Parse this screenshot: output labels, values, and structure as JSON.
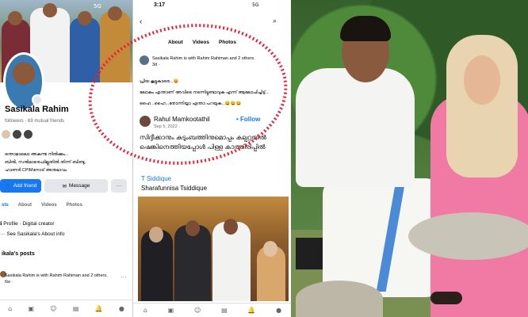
{
  "left": {
    "status_bar": "5G",
    "profile_name": "Sasikala Rahim",
    "followers_label": "followers",
    "mutual_friends": "69 mutual friends",
    "bio_lines": [
      "ന്തൊമാലൊ അകന്നു നിൽക്കും...",
      "ബിൽ, സൽമാരെഫില്ലതിൽ തിന്ന് ബിണ്ടു,",
      "ഹാണർ CPIMനോട് അനുഭാവം"
    ],
    "add_friend_label": "Add friend",
    "message_label": "Message",
    "more_label": "···",
    "tabs": [
      "sts",
      "About",
      "Videos",
      "Photos"
    ],
    "details": [
      "Profile · Digital creator",
      "See Sasikala's About info"
    ],
    "posts_heading": "ikala's posts",
    "post_line": "Sasikala Rahim is with Rahim Rahiman and 2 others.",
    "post_line_meta": "6w · ",
    "post_more": "···"
  },
  "mid": {
    "time": "3:17",
    "status_icons": "5G",
    "back_icon": "‹",
    "search_icon": "⌕",
    "tabs": [
      "About",
      "Videos",
      "Photos"
    ],
    "post_header": "Sasikala Rahim is with Rahim Rahiman and 2 others.",
    "post_meta": "3d · ",
    "post_line1": "പ്രിയ കൂട്ടുകാരെ...😀",
    "post_line2": "ലോകം എന്താണ് അവിടെ നടന്നിട്ടുണ്ടാവുക എന്ന് ആലോചിച്ചിട്ട്...",
    "post_line3": "ഹൈ...ഹൈ...തോന്നിയ്യാ എന്താ പറയുക...😀😀😀",
    "shared_name": "Rahul Mamkootathil",
    "shared_follow": "Follow",
    "shared_date": "Sep 5, 2022 · ",
    "shared_text": "സിദ്ദീക്കാനും കുടുംബത്തിനുമൊപ്പം കല്പറ്റയിൽ ഷെങ്കിനെത്തിയപ്പോൾ പിള്ള കാത്തിരിപ്പിൽ",
    "tag1": "T Siddique",
    "tag2": "Sharafunnisa Tsiddique"
  },
  "colors": {
    "fb_blue": "#1877f2",
    "circle_red": "#e8213a"
  }
}
